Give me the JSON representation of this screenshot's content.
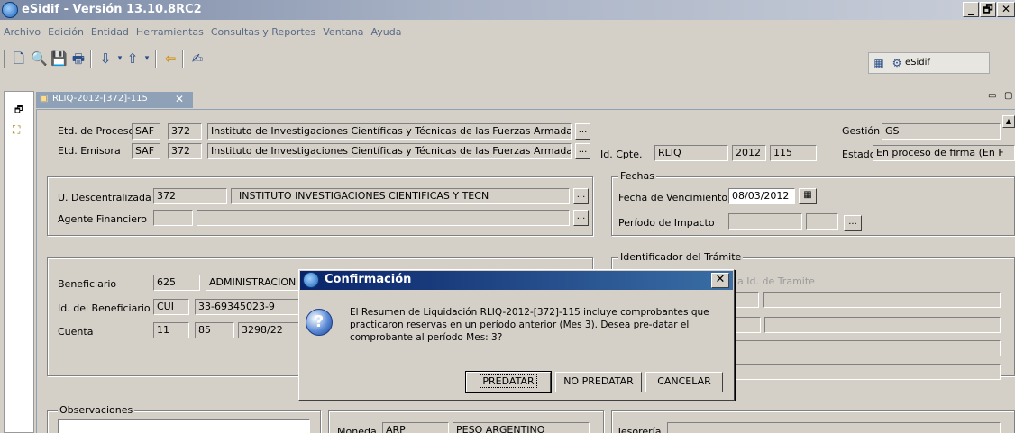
{
  "window": {
    "title": "eSidif - Versión 13.10.8RC2",
    "minimize": "_",
    "restore": "🗗",
    "close": "✕"
  },
  "menu": [
    "Archivo",
    "Edición",
    "Entidad",
    "Herramientas",
    "Consultas y Reportes",
    "Ventana",
    "Ayuda"
  ],
  "toolbar": {
    "perspective_label": "eSidif"
  },
  "tab": {
    "label": "RLIQ-2012-[372]-115",
    "close": "✕"
  },
  "form": {
    "etd_proceso_label": "Etd. de Proceso",
    "etd_proceso_tipo": "SAF",
    "etd_proceso_codigo": "372",
    "etd_proceso_nombre": "Instituto de Investigaciones Científicas y Técnicas de las Fuerzas Armadas",
    "etd_emisora_label": "Etd. Emisora",
    "etd_emisora_tipo": "SAF",
    "etd_emisora_codigo": "372",
    "etd_emisora_nombre": "Instituto de Investigaciones Científicas y Técnicas de las Fuerzas Armadas",
    "gestion_label": "Gestión",
    "gestion_value": "GS",
    "id_cpte_label": "Id. Cpte.",
    "id_cpte_tipo": "RLIQ",
    "id_cpte_anio": "2012",
    "id_cpte_numero": "115",
    "estado_label": "Estado",
    "estado_value": "En proceso de firma (En F",
    "u_descentralizada_label": "U. Descentralizada",
    "u_descentralizada_codigo": "372",
    "u_descentralizada_nombre": "INSTITUTO  INVESTIGACIONES CIENTIFICAS Y TECN",
    "agente_financiero_label": "Agente Financiero",
    "fechas_label": "Fechas",
    "fecha_vencimiento_label": "Fecha de Vencimiento",
    "fecha_vencimiento_value": "08/03/2012",
    "periodo_impacto_label": "Período de Impacto",
    "identificador_tramite_label": "Identificador del Trámite",
    "id_tramite_partial": "a Id. de Tramite",
    "beneficiario_label": "Beneficiario",
    "beneficiario_codigo": "625",
    "beneficiario_nombre": "ADMINISTRACION",
    "id_beneficiario_label": "Id. del Beneficiario",
    "id_beneficiario_tipo": "CUI",
    "id_beneficiario_value": "33-69345023-9",
    "cuenta_label": "Cuenta",
    "cuenta_a": "11",
    "cuenta_b": "85",
    "cuenta_c": "3298/22",
    "observaciones_label": "Observaciones",
    "moneda_label": "Moneda",
    "moneda_codigo": "ARP",
    "moneda_nombre": "PESO ARGENTINO",
    "tesoreria_label": "Tesorería",
    "dots": "..."
  },
  "dialog": {
    "title": "Confirmación",
    "close": "✕",
    "icon": "?",
    "message": "El Resumen de Liquidación RLIQ-2012-[372]-115 incluye comprobantes que practicaron reservas en un período anterior (Mes 3). Desea pre-datar el comprobante al período Mes: 3?",
    "buttons": {
      "predatar": "PREDATAR",
      "no_predatar": "NO PREDATAR",
      "cancelar": "CANCELAR"
    }
  }
}
